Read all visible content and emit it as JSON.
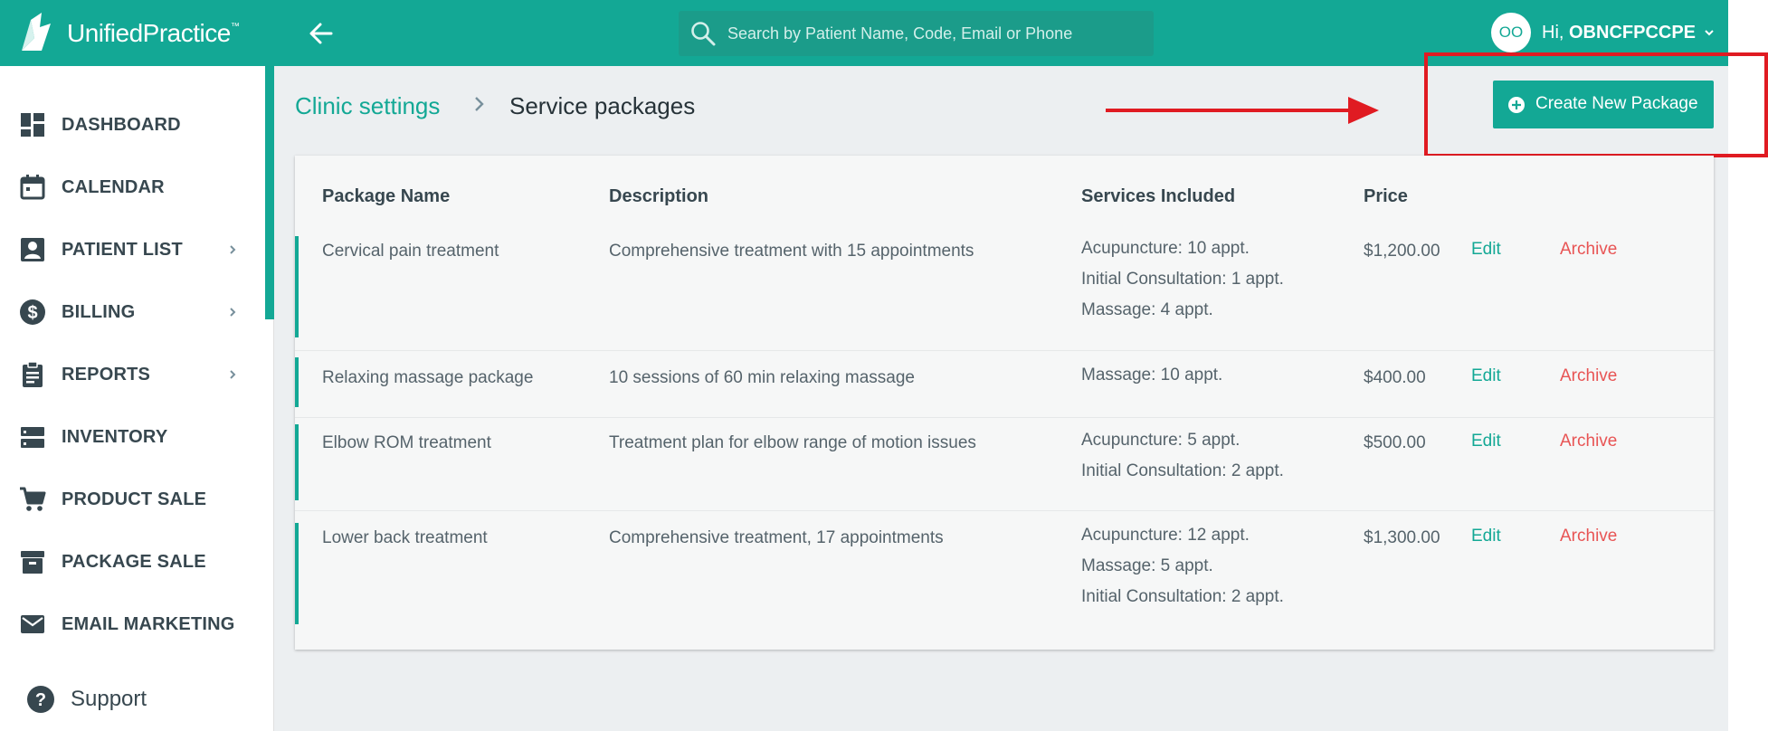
{
  "app": {
    "logo_text_a": "Unified",
    "logo_text_b": "Practice",
    "logo_tm": "™"
  },
  "search": {
    "placeholder": "Search by Patient Name, Code, Email or Phone"
  },
  "user": {
    "initials": "OO",
    "greeting": "Hi, ",
    "name": "OBNCFPCCPE"
  },
  "sidebar": {
    "items": [
      {
        "label": "DASHBOARD",
        "icon": "dashboard-icon"
      },
      {
        "label": "CALENDAR",
        "icon": "calendar-icon"
      },
      {
        "label": "PATIENT LIST",
        "icon": "patient-list-icon"
      },
      {
        "label": "BILLING",
        "icon": "billing-icon"
      },
      {
        "label": "REPORTS",
        "icon": "reports-icon"
      },
      {
        "label": "INVENTORY",
        "icon": "inventory-icon"
      },
      {
        "label": "PRODUCT SALE",
        "icon": "cart-icon"
      },
      {
        "label": "PACKAGE SALE",
        "icon": "archive-box-icon"
      },
      {
        "label": "EMAIL MARKETING",
        "icon": "mail-icon"
      }
    ],
    "support": "Support"
  },
  "breadcrumb": {
    "parent": "Clinic settings",
    "current": "Service packages"
  },
  "actions": {
    "create_label": "Create New Package"
  },
  "table": {
    "headers": [
      "Package Name",
      "Description",
      "Services Included",
      "Price"
    ],
    "rows": [
      {
        "name": "Cervical pain treatment",
        "description": "Comprehensive treatment with 15 appointments",
        "services": [
          "Acupuncture: 10 appt.",
          "Initial Consultation: 1 appt.",
          "Massage: 4 appt."
        ],
        "price": "$1,200.00"
      },
      {
        "name": "Relaxing massage package",
        "description": "10 sessions of 60 min relaxing massage",
        "services": [
          "Massage: 10 appt."
        ],
        "price": "$400.00"
      },
      {
        "name": "Elbow ROM treatment",
        "description": "Treatment plan for elbow range of motion issues",
        "services": [
          "Acupuncture: 5 appt.",
          "Initial Consultation: 2 appt."
        ],
        "price": "$500.00"
      },
      {
        "name": "Lower back treatment",
        "description": "Comprehensive treatment, 17 appointments",
        "services": [
          "Acupuncture: 12 appt.",
          "Massage: 5 appt.",
          "Initial Consultation: 2 appt."
        ],
        "price": "$1,300.00"
      }
    ],
    "edit_label": "Edit",
    "archive_label": "Archive"
  },
  "colors": {
    "brand": "#13a895",
    "danger": "#e85454",
    "annotation": "#e01b22"
  }
}
